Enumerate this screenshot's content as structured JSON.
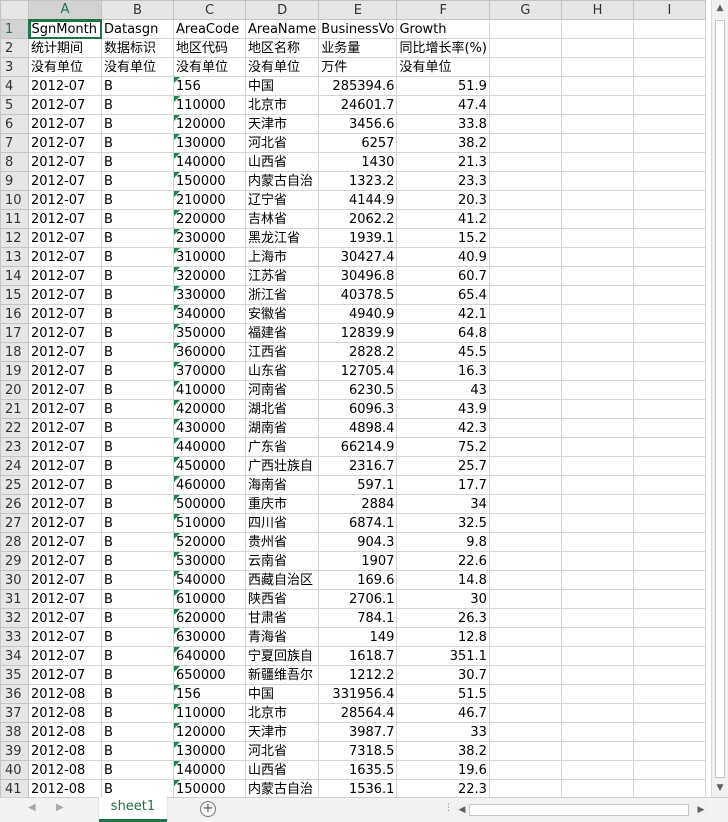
{
  "columns": [
    "A",
    "B",
    "C",
    "D",
    "E",
    "F",
    "G",
    "H",
    "I"
  ],
  "row_numbers": [
    "1",
    "2",
    "3",
    "4",
    "5",
    "6",
    "7",
    "8",
    "9",
    "10",
    "11",
    "12",
    "13",
    "14",
    "15",
    "16",
    "17",
    "18",
    "19",
    "20",
    "21",
    "22",
    "23",
    "24",
    "25",
    "26",
    "27",
    "28",
    "29",
    "30",
    "31",
    "32",
    "33",
    "34",
    "35",
    "36",
    "37",
    "38",
    "39",
    "40",
    "41"
  ],
  "header_rows": [
    [
      "SgnMonth",
      "Datasgn",
      "AreaCode",
      "AreaName",
      "BusinessVo",
      "Growth"
    ],
    [
      "统计期间",
      "数据标识",
      "地区代码",
      "地区名称",
      "业务量",
      "同比增长率(%)"
    ],
    [
      "没有单位",
      "没有单位",
      "没有单位",
      "没有单位",
      "万件",
      "没有单位"
    ]
  ],
  "data_rows": [
    [
      "2012-07",
      "B",
      "156",
      "中国",
      "285394.6",
      "51.9"
    ],
    [
      "2012-07",
      "B",
      "110000",
      "北京市",
      "24601.7",
      "47.4"
    ],
    [
      "2012-07",
      "B",
      "120000",
      "天津市",
      "3456.6",
      "33.8"
    ],
    [
      "2012-07",
      "B",
      "130000",
      "河北省",
      "6257",
      "38.2"
    ],
    [
      "2012-07",
      "B",
      "140000",
      "山西省",
      "1430",
      "21.3"
    ],
    [
      "2012-07",
      "B",
      "150000",
      "内蒙古自治",
      "1323.2",
      "23.3"
    ],
    [
      "2012-07",
      "B",
      "210000",
      "辽宁省",
      "4144.9",
      "20.3"
    ],
    [
      "2012-07",
      "B",
      "220000",
      "吉林省",
      "2062.2",
      "41.2"
    ],
    [
      "2012-07",
      "B",
      "230000",
      "黑龙江省",
      "1939.1",
      "15.2"
    ],
    [
      "2012-07",
      "B",
      "310000",
      "上海市",
      "30427.4",
      "40.9"
    ],
    [
      "2012-07",
      "B",
      "320000",
      "江苏省",
      "30496.8",
      "60.7"
    ],
    [
      "2012-07",
      "B",
      "330000",
      "浙江省",
      "40378.5",
      "65.4"
    ],
    [
      "2012-07",
      "B",
      "340000",
      "安徽省",
      "4940.9",
      "42.1"
    ],
    [
      "2012-07",
      "B",
      "350000",
      "福建省",
      "12839.9",
      "64.8"
    ],
    [
      "2012-07",
      "B",
      "360000",
      "江西省",
      "2828.2",
      "45.5"
    ],
    [
      "2012-07",
      "B",
      "370000",
      "山东省",
      "12705.4",
      "16.3"
    ],
    [
      "2012-07",
      "B",
      "410000",
      "河南省",
      "6230.5",
      "43"
    ],
    [
      "2012-07",
      "B",
      "420000",
      "湖北省",
      "6096.3",
      "43.9"
    ],
    [
      "2012-07",
      "B",
      "430000",
      "湖南省",
      "4898.4",
      "42.3"
    ],
    [
      "2012-07",
      "B",
      "440000",
      "广东省",
      "66214.9",
      "75.2"
    ],
    [
      "2012-07",
      "B",
      "450000",
      "广西壮族自",
      "2316.7",
      "25.7"
    ],
    [
      "2012-07",
      "B",
      "460000",
      "海南省",
      "597.1",
      "17.7"
    ],
    [
      "2012-07",
      "B",
      "500000",
      "重庆市",
      "2884",
      "34"
    ],
    [
      "2012-07",
      "B",
      "510000",
      "四川省",
      "6874.1",
      "32.5"
    ],
    [
      "2012-07",
      "B",
      "520000",
      "贵州省",
      "904.3",
      "9.8"
    ],
    [
      "2012-07",
      "B",
      "530000",
      "云南省",
      "1907",
      "22.6"
    ],
    [
      "2012-07",
      "B",
      "540000",
      "西藏自治区",
      "169.6",
      "14.8"
    ],
    [
      "2012-07",
      "B",
      "610000",
      "陕西省",
      "2706.1",
      "30"
    ],
    [
      "2012-07",
      "B",
      "620000",
      "甘肃省",
      "784.1",
      "26.3"
    ],
    [
      "2012-07",
      "B",
      "630000",
      "青海省",
      "149",
      "12.8"
    ],
    [
      "2012-07",
      "B",
      "640000",
      "宁夏回族自",
      "1618.7",
      "351.1"
    ],
    [
      "2012-07",
      "B",
      "650000",
      "新疆维吾尔",
      "1212.2",
      "30.7"
    ],
    [
      "2012-08",
      "B",
      "156",
      "中国",
      "331956.4",
      "51.5"
    ],
    [
      "2012-08",
      "B",
      "110000",
      "北京市",
      "28564.4",
      "46.7"
    ],
    [
      "2012-08",
      "B",
      "120000",
      "天津市",
      "3987.7",
      "33"
    ],
    [
      "2012-08",
      "B",
      "130000",
      "河北省",
      "7318.5",
      "38.2"
    ],
    [
      "2012-08",
      "B",
      "140000",
      "山西省",
      "1635.5",
      "19.6"
    ],
    [
      "2012-08",
      "B",
      "150000",
      "内蒙古自治",
      "1536.1",
      "22.3"
    ]
  ],
  "sheet_tab": "sheet1",
  "icons": {
    "add_sheet": "plus-circle-icon",
    "nav_prev": "triangle-left-icon",
    "nav_next": "triangle-right-icon"
  },
  "colors": {
    "accent": "#217346",
    "error_marker": "#1e8449"
  }
}
